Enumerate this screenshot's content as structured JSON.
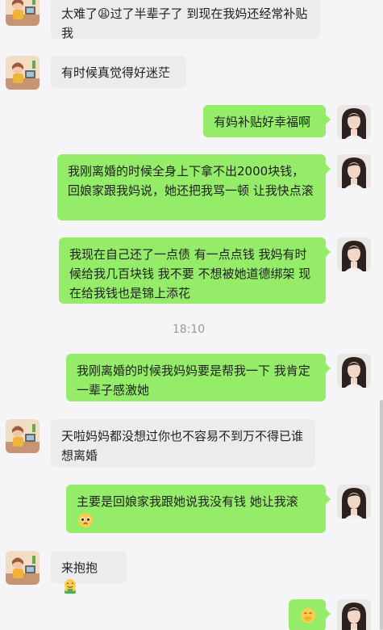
{
  "chat": {
    "timestamp": "18:10",
    "messages": [
      {
        "side": "in",
        "text": "太难了😩过了半辈子了 到现在我妈还经常补贴我"
      },
      {
        "side": "in",
        "text": "有时候真觉得好迷茫"
      },
      {
        "side": "out",
        "text": "有妈补贴好幸福啊"
      },
      {
        "side": "out",
        "text": "我刚离婚的时候全身上下拿不出2000块钱，回娘家跟我妈说，她还把我骂一顿 让我快点滚"
      },
      {
        "side": "out",
        "text": "我现在自己还了一点债  有一点点钱 我妈有时候给我几百块钱  我不要  不想被她道德绑架   现在给我钱也是锦上添花"
      },
      {
        "side": "out",
        "text": "我刚离婚的时候我妈妈要是帮我一下  我肯定一辈子感激她"
      },
      {
        "side": "in",
        "text": "天啦妈妈都没想过你也不容易不到万不得已谁想离婚"
      },
      {
        "side": "out",
        "text": "主要是回娘家我跟她说我没有钱  她让我滚",
        "emoji": "pleading-face"
      },
      {
        "side": "in",
        "text": "来抱抱",
        "emoji": "hugging-face"
      },
      {
        "side": "out",
        "text": "",
        "emoji": "hand-over-mouth-face"
      }
    ]
  },
  "colors": {
    "background": "#f5f5f7",
    "incoming_bubble": "#ececef",
    "outgoing_bubble": "#95ec69",
    "timestamp_text": "#9a9a9a"
  },
  "icons": {
    "contact_avatar": "contact-avatar",
    "self_avatar": "self-avatar"
  }
}
